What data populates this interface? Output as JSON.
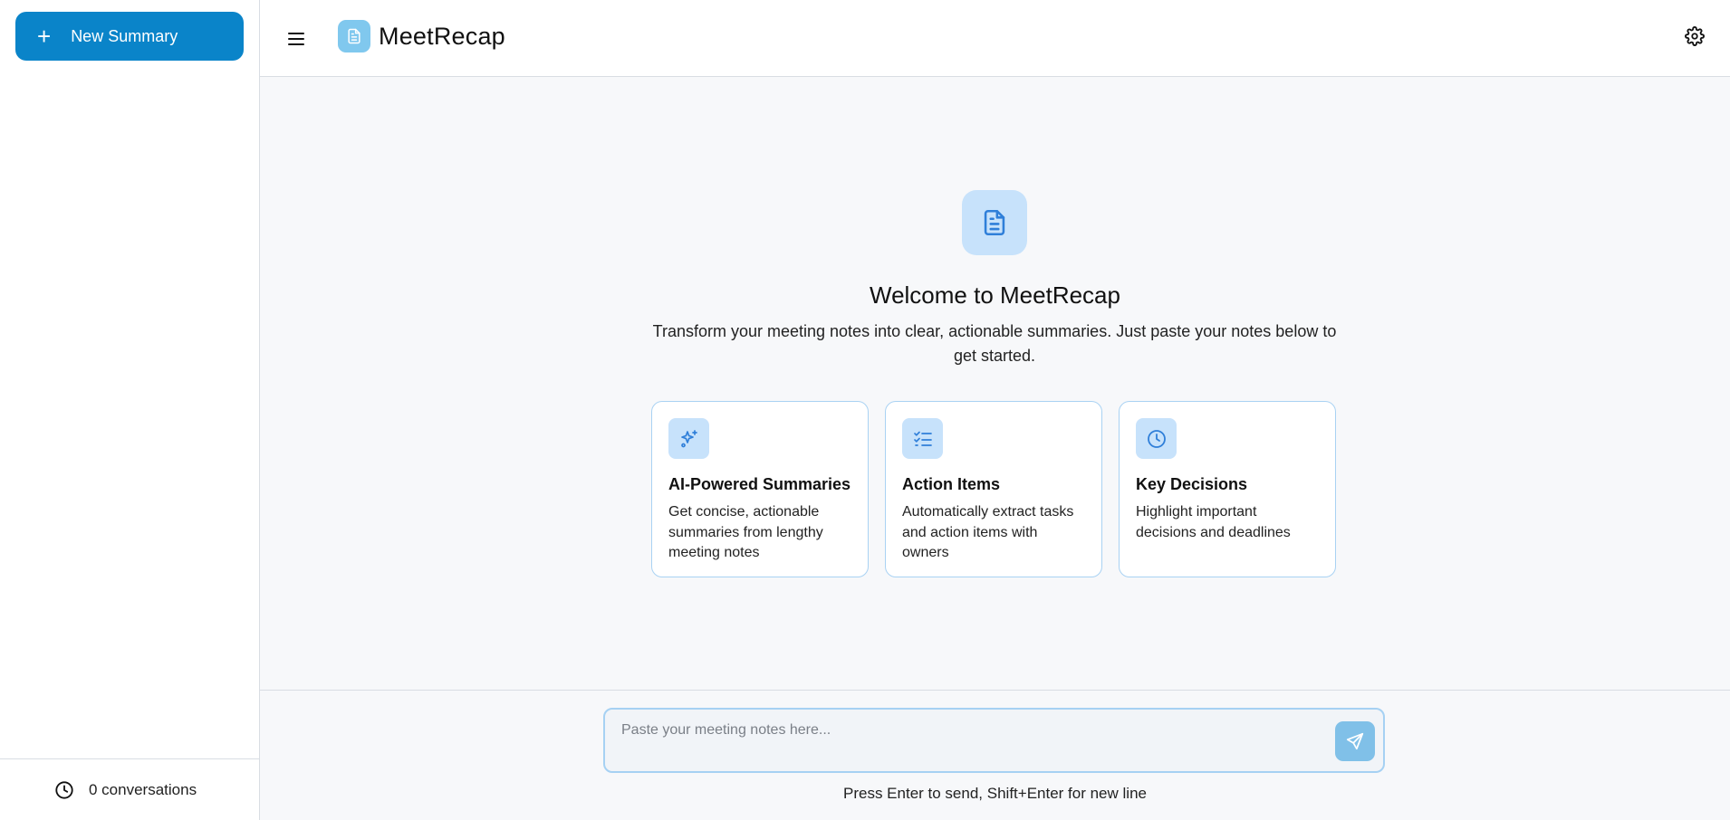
{
  "sidebar": {
    "new_button_label": "New Summary",
    "new_button_icon": "plus-icon",
    "footer_icon": "clock-icon",
    "footer_label": "0 conversations"
  },
  "header": {
    "menu_icon": "hamburger-icon",
    "app_title": "MeetRecap",
    "logo_icon": "document-icon",
    "settings_icon": "gear-icon"
  },
  "welcome": {
    "icon": "document-icon",
    "title": "Welcome to MeetRecap",
    "subtitle": "Transform your meeting notes into clear, actionable summaries. Just paste your notes below to get started."
  },
  "features": [
    {
      "icon": "sparkles-icon",
      "title": "AI-Powered Summaries",
      "description": "Get concise, actionable summaries from lengthy meeting notes"
    },
    {
      "icon": "checklist-icon",
      "title": "Action Items",
      "description": "Automatically extract tasks and action items with owners"
    },
    {
      "icon": "clock-icon",
      "title": "Key Decisions",
      "description": "Highlight important decisions and deadlines"
    }
  ],
  "composer": {
    "placeholder": "Paste your meeting notes here...",
    "value": "",
    "send_icon": "send-icon",
    "hint": "Press Enter to send, Shift+Enter for new line"
  },
  "colors": {
    "primary": "#0a84c9",
    "accent_light": "#c7e2fb",
    "icon_blue": "#2f7fd9",
    "send_button": "#80c0e8",
    "card_border": "#a9d2f3"
  }
}
